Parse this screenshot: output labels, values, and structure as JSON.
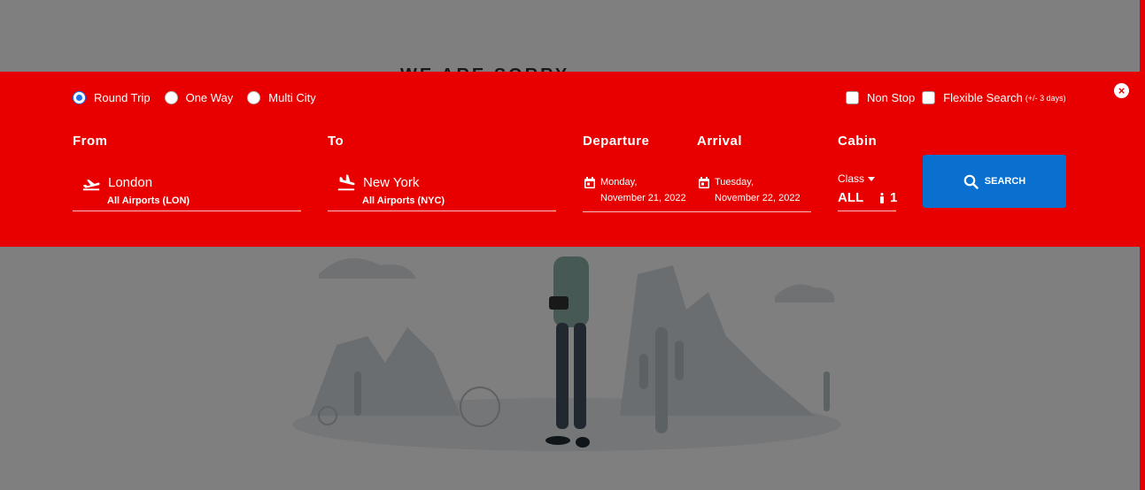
{
  "background": {
    "heading": "WE ARE SORRY"
  },
  "trip_type": {
    "options": [
      {
        "label": "Round Trip",
        "checked": true
      },
      {
        "label": "One Way",
        "checked": false
      },
      {
        "label": "Multi City",
        "checked": false
      }
    ]
  },
  "filters": {
    "non_stop": "Non Stop",
    "flexible": "Flexible Search",
    "flexible_note": "(+/- 3 days)"
  },
  "close": "×",
  "from": {
    "label": "From",
    "city": "London",
    "airports": "All Airports (LON)",
    "icon": "plane-takeoff-icon"
  },
  "to": {
    "label": "To",
    "city": "New York",
    "airports": "All Airports (NYC)",
    "icon": "plane-landing-icon"
  },
  "departure": {
    "label": "Departure",
    "day": "Monday,",
    "date": "November 21, 2022",
    "icon": "calendar-icon"
  },
  "arrival": {
    "label": "Arrival",
    "day": "Tuesday,",
    "date": "November 22, 2022",
    "icon": "calendar-icon"
  },
  "cabin": {
    "label": "Cabin",
    "class_label": "Class",
    "class_value": "ALL",
    "passengers": "1"
  },
  "search": {
    "label": "SEARCH"
  },
  "colors": {
    "panel": "#e80000",
    "search_button": "#0a70d0",
    "radio_selected": "#1a73e8"
  }
}
